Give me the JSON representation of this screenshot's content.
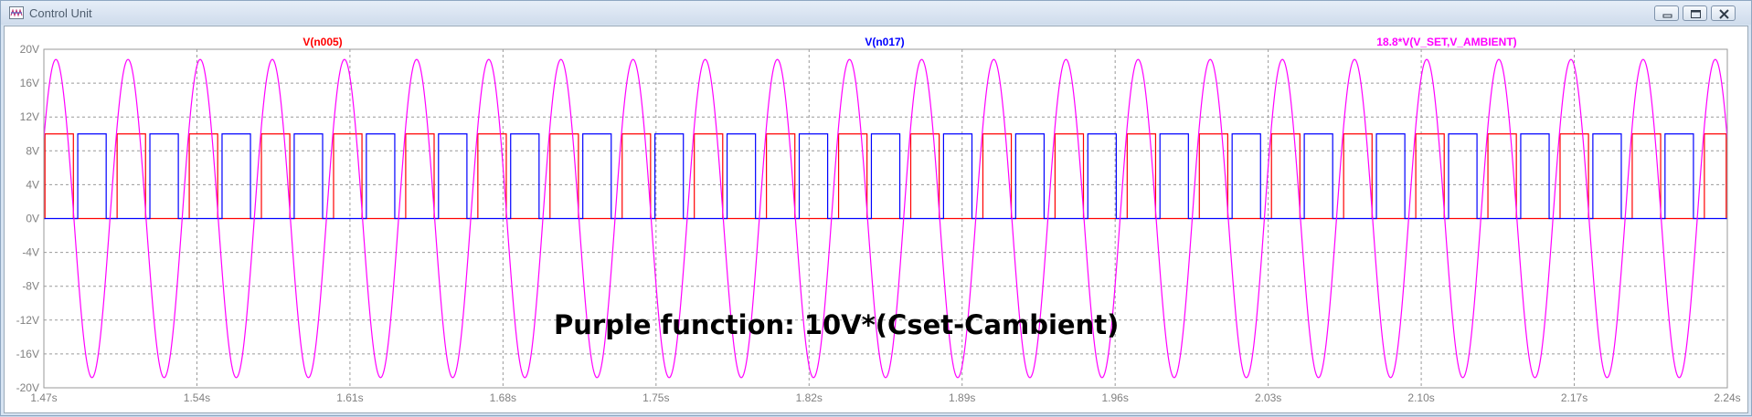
{
  "window": {
    "title": "Control Unit",
    "app_icon": "waveform-icon",
    "buttons": {
      "minimize": "minimize-icon",
      "maximize": "maximize-icon",
      "close": "close-icon"
    }
  },
  "annotation": "Purple function: 10V*(Cset-Cambient)",
  "chart_data": {
    "type": "line",
    "title": "",
    "xlabel": "",
    "ylabel": "",
    "grid": true,
    "xlim": [
      1.47,
      2.24
    ],
    "ylim": [
      -20,
      20
    ],
    "x_ticks": [
      1.47,
      1.54,
      1.61,
      1.68,
      1.75,
      1.82,
      1.89,
      1.96,
      2.03,
      2.1,
      2.17,
      2.24
    ],
    "x_tick_labels": [
      "1.47s",
      "1.54s",
      "1.61s",
      "1.68s",
      "1.75s",
      "1.82s",
      "1.89s",
      "1.96s",
      "2.03s",
      "2.10s",
      "2.17s",
      "2.24s"
    ],
    "y_ticks": [
      20,
      16,
      12,
      8,
      4,
      0,
      -4,
      -8,
      -12,
      -16,
      -20
    ],
    "y_tick_labels": [
      "20V",
      "16V",
      "12V",
      "8V",
      "4V",
      "0V",
      "-4V",
      "-8V",
      "-12V",
      "-16V",
      "-20V"
    ],
    "series": [
      {
        "name": "V(n005)",
        "color": "#ff0000",
        "kind": "square",
        "low": 0,
        "high": 10,
        "high_intervals": [
          [
            1.4705,
            1.4835
          ],
          [
            1.5035,
            1.5165
          ],
          [
            1.5365,
            1.5495
          ],
          [
            1.5695,
            1.5825
          ],
          [
            1.6025,
            1.6155
          ],
          [
            1.6355,
            1.6485
          ],
          [
            1.6685,
            1.6815
          ],
          [
            1.7015,
            1.7145
          ],
          [
            1.7345,
            1.7475
          ],
          [
            1.7675,
            1.7805
          ],
          [
            1.8005,
            1.8135
          ],
          [
            1.8335,
            1.8465
          ],
          [
            1.8665,
            1.8795
          ],
          [
            1.8995,
            1.9125
          ],
          [
            1.9325,
            1.9455
          ],
          [
            1.9655,
            1.9785
          ],
          [
            1.9985,
            2.0115
          ],
          [
            2.0315,
            2.0445
          ],
          [
            2.0645,
            2.0775
          ],
          [
            2.0975,
            2.1105
          ],
          [
            2.1305,
            2.1435
          ],
          [
            2.1635,
            2.1765
          ],
          [
            2.1965,
            2.2095
          ],
          [
            2.2295,
            2.2395
          ]
        ]
      },
      {
        "name": "V(n017)",
        "color": "#0000ff",
        "kind": "square",
        "low": 0,
        "high": 10,
        "high_intervals": [
          [
            1.4855,
            1.4985
          ],
          [
            1.5185,
            1.5315
          ],
          [
            1.5515,
            1.5645
          ],
          [
            1.5845,
            1.5975
          ],
          [
            1.6175,
            1.6305
          ],
          [
            1.6505,
            1.6635
          ],
          [
            1.6835,
            1.6965
          ],
          [
            1.7165,
            1.7295
          ],
          [
            1.7495,
            1.7625
          ],
          [
            1.7825,
            1.7955
          ],
          [
            1.8155,
            1.8285
          ],
          [
            1.8485,
            1.8615
          ],
          [
            1.8815,
            1.8945
          ],
          [
            1.9145,
            1.9275
          ],
          [
            1.9475,
            1.9605
          ],
          [
            1.9805,
            1.9935
          ],
          [
            2.0135,
            2.0265
          ],
          [
            2.0465,
            2.0595
          ],
          [
            2.0795,
            2.0925
          ],
          [
            2.1125,
            2.1255
          ],
          [
            2.1455,
            2.1585
          ],
          [
            2.1785,
            2.1915
          ],
          [
            2.2115,
            2.2245
          ]
        ]
      },
      {
        "name": "18.8*V(V_SET,V_AMBIENT)",
        "color": "#ff00ff",
        "kind": "sine",
        "amplitude": 18.8,
        "period": 0.033,
        "peak_time": 1.4755
      }
    ]
  }
}
